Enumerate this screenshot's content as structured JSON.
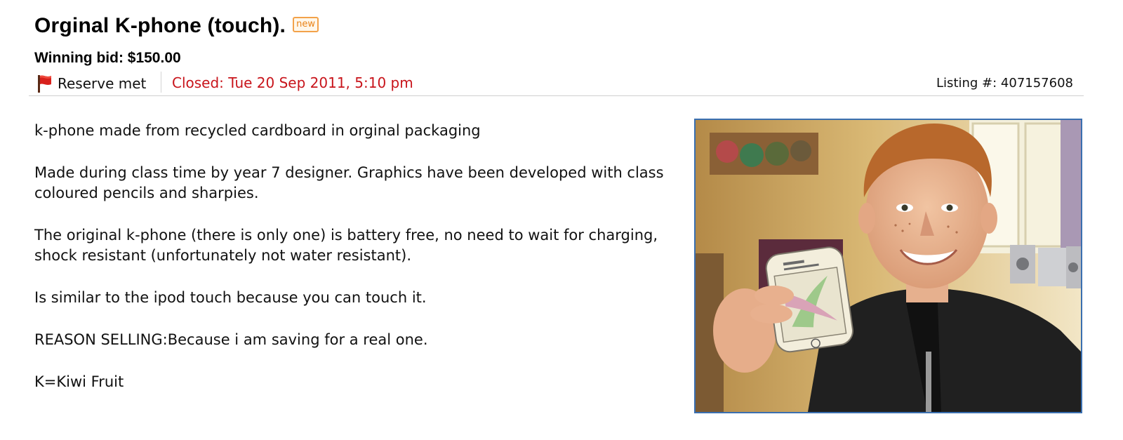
{
  "listing": {
    "title": "Orginal K-phone (touch).",
    "badge": "new",
    "winning_bid": "Winning bid: $150.00",
    "reserve_status": "Reserve met",
    "closed": "Closed: Tue 20 Sep 2011, 5:10 pm",
    "listing_number": "Listing #: 407157608"
  },
  "description": [
    "k-phone made from recycled cardboard in orginal packaging",
    "Made during class time by year 7 designer. Graphics have been developed with class coloured pencils and sharpies.",
    "The original k-phone (there is only one) is battery free, no need to wait for charging, shock resistant (unfortunately not water resistant).",
    "Is similar to the ipod touch because you can touch it.",
    "REASON SELLING:Because i am saving for a real one.",
    "K=Kiwi Fruit"
  ],
  "icons": {
    "reserve": "red-flag-icon"
  },
  "colors": {
    "closed_text": "#c8141b",
    "badge_text": "#e98317",
    "photo_border": "#3a6fb0"
  }
}
